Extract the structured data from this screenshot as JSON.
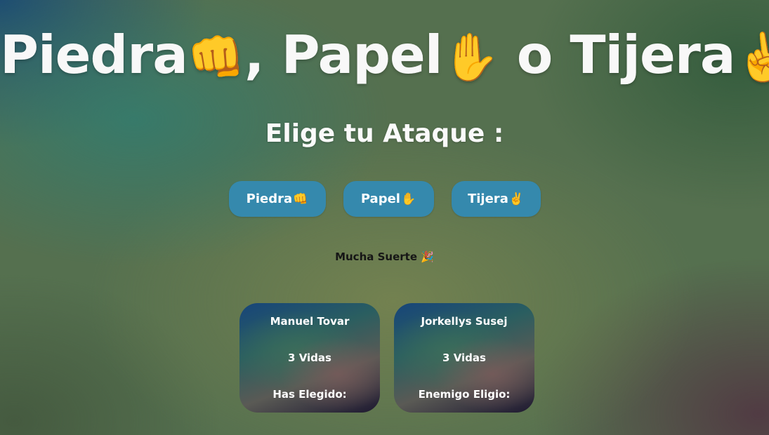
{
  "header": {
    "title_parts": {
      "piedra": "Piedra",
      "piedra_emoji": "👊",
      "sep1": ", ",
      "papel": "Papel",
      "papel_emoji": "✋",
      "sep2": " o ",
      "tijera": "Tijera",
      "tijera_emoji": "✌️"
    },
    "subtitle": "Elige tu Ataque :"
  },
  "attacks": {
    "piedra_label": "Piedra",
    "piedra_emoji": "👊",
    "papel_label": "Papel",
    "papel_emoji": "✋",
    "tijera_label": "Tijera",
    "tijera_emoji": "✌️"
  },
  "status": {
    "message": "Mucha Suerte 🎉"
  },
  "players": {
    "player": {
      "name": "Manuel Tovar",
      "lives": "3 Vidas",
      "choice_label": "Has Elegido:"
    },
    "enemy": {
      "name": "Jorkellys Susej",
      "lives": "3 Vidas",
      "choice_label": "Enemigo Eligio:"
    }
  },
  "colors": {
    "button_bg": "#3589ad",
    "title_text": "#f8f8f8",
    "status_text": "#161616"
  }
}
